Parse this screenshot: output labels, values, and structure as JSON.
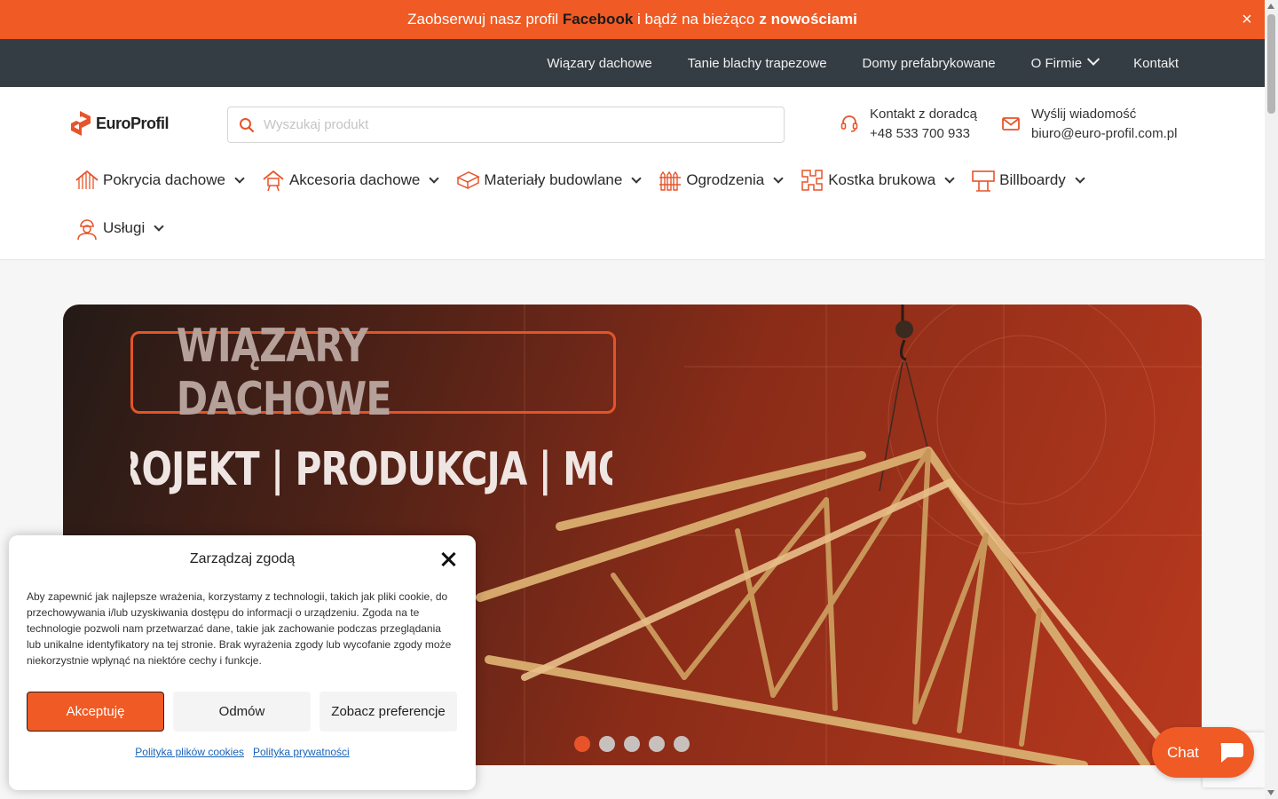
{
  "banner": {
    "text_before": "Zaobserwuj nasz profil",
    "facebook": "Facebook",
    "text_middle": "i bądź na bieżąco",
    "text_bold": "z nowościami",
    "close_label": "×"
  },
  "top_nav": {
    "items": [
      {
        "label": "Wiązary dachowe"
      },
      {
        "label": "Tanie blachy trapezowe"
      },
      {
        "label": "Domy prefabrykowane"
      },
      {
        "label": "O Firmie"
      },
      {
        "label": "Kontakt"
      }
    ]
  },
  "header": {
    "logo_text": "EuroProfil",
    "search": {
      "placeholder": "Wyszukaj produkt",
      "icon": "search-icon"
    },
    "contact_phone": {
      "label": "Kontakt z doradcą",
      "value": "+48 533 700 933",
      "icon": "headset-icon"
    },
    "contact_email": {
      "label": "Wyślij wiadomość",
      "value": "biuro@euro-profil.com.pl",
      "icon": "mail-icon"
    }
  },
  "categories": [
    {
      "label": "Pokrycia dachowe",
      "icon": "roof-icon"
    },
    {
      "label": "Akcesoria dachowe",
      "icon": "roof-accessories-icon"
    },
    {
      "label": "Materiały budowlane",
      "icon": "building-materials-icon"
    },
    {
      "label": "Ogrodzenia",
      "icon": "fence-icon"
    },
    {
      "label": "Kostka brukowa",
      "icon": "paving-icon"
    },
    {
      "label": "Billboardy",
      "icon": "billboard-icon"
    },
    {
      "label": "Usługi",
      "icon": "worker-icon"
    }
  ],
  "hero": {
    "title": "WIĄZARY DACHOWE",
    "subtitle": "ROJEKT | PRODUKCJA | MONTA",
    "slides": 5,
    "active_slide": 1
  },
  "consent": {
    "title": "Zarządzaj zgodą",
    "text": "Aby zapewnić jak najlepsze wrażenia, korzystamy z technologii, takich jak pliki cookie, do przechowywania i/lub uzyskiwania dostępu do informacji o urządzeniu. Zgoda na te technologie pozwoli nam przetwarzać dane, takie jak zachowanie podczas przeglądania lub unikalne identyfikatory na tej stronie. Brak wyrażenia zgody lub wycofanie zgody może niekorzystnie wpłynąć na niektóre cechy i funkcje.",
    "accept": "Akceptuję",
    "deny": "Odmów",
    "preferences": "Zobacz preferencje",
    "cookie_policy": "Polityka plików cookies",
    "privacy_policy": "Polityka prywatności"
  },
  "chat": {
    "label": "Chat",
    "icon": "chat-bubble-icon"
  },
  "colors": {
    "accent": "#f05a24",
    "nav_dark": "#353d44"
  }
}
